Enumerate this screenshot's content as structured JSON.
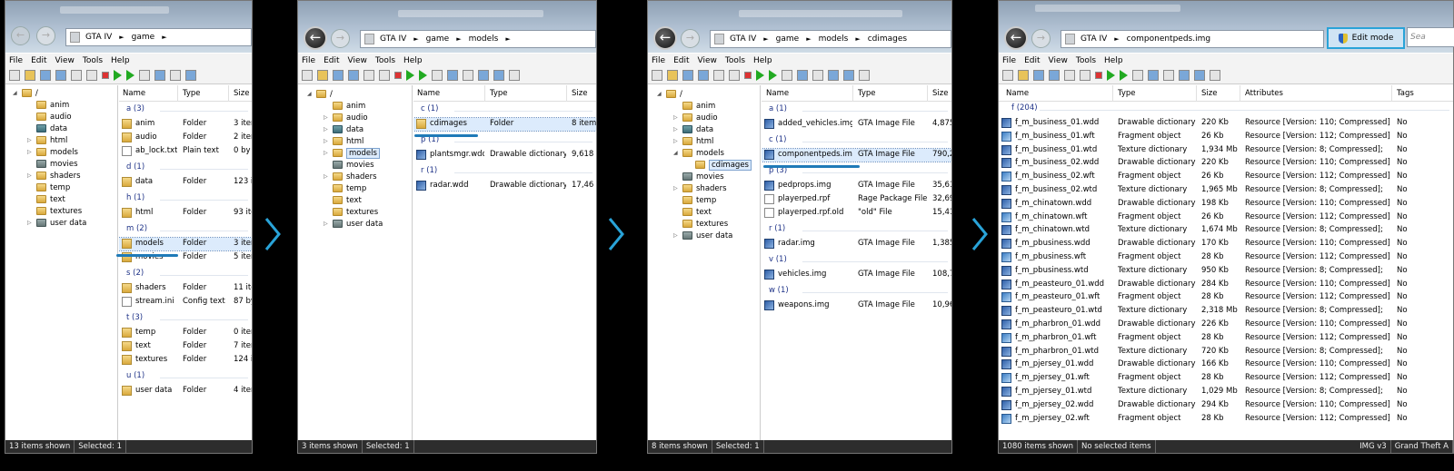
{
  "menu": [
    "File",
    "Edit",
    "View",
    "Tools",
    "Help"
  ],
  "columns": {
    "name": "Name",
    "type": "Type",
    "size": "Size",
    "attributes": "Attributes",
    "tags": "Tags"
  },
  "p1": {
    "breadcrumb": [
      "GTA IV",
      "game"
    ],
    "tree_root": "/",
    "tree": [
      "anim",
      "audio",
      "data",
      "html",
      "models",
      "movies",
      "shaders",
      "temp",
      "text",
      "textures",
      "user data"
    ],
    "groups": [
      {
        "label": "a (3)",
        "rows": [
          [
            "anim",
            "Folder",
            "3 item"
          ],
          [
            "audio",
            "Folder",
            "2 item"
          ],
          [
            "ab_lock.txt",
            "Plain text",
            "0 by"
          ]
        ]
      },
      {
        "label": "d (1)",
        "rows": [
          [
            "data",
            "Folder",
            "123 it"
          ]
        ]
      },
      {
        "label": "h (1)",
        "rows": [
          [
            "html",
            "Folder",
            "93 ite"
          ]
        ]
      },
      {
        "label": "m (2)",
        "rows": [
          [
            "models",
            "Folder",
            "3 item"
          ],
          [
            "movies",
            "Folder",
            "5 item"
          ]
        ]
      },
      {
        "label": "s (2)",
        "rows": [
          [
            "shaders",
            "Folder",
            "11 ite"
          ],
          [
            "stream.ini",
            "Config text",
            "87 by"
          ]
        ]
      },
      {
        "label": "t (3)",
        "rows": [
          [
            "temp",
            "Folder",
            "0 item"
          ],
          [
            "text",
            "Folder",
            "7 item"
          ],
          [
            "textures",
            "Folder",
            "124 it"
          ]
        ]
      },
      {
        "label": "u (1)",
        "rows": [
          [
            "user data",
            "Folder",
            "4 item"
          ]
        ]
      }
    ],
    "status": [
      "13 items shown",
      "Selected: 1"
    ]
  },
  "p2": {
    "breadcrumb": [
      "GTA IV",
      "game",
      "models"
    ],
    "tree_root": "/",
    "tree": [
      "anim",
      "audio",
      "data",
      "html",
      "models",
      "movies",
      "shaders",
      "temp",
      "text",
      "textures",
      "user data"
    ],
    "groups": [
      {
        "label": "c (1)",
        "rows": [
          [
            "cdimages",
            "Folder",
            "8 items"
          ]
        ]
      },
      {
        "label": "p (1)",
        "rows": [
          [
            "plantsmgr.wdd",
            "Drawable dictionary",
            "9,618 K"
          ]
        ]
      },
      {
        "label": "r (1)",
        "rows": [
          [
            "radar.wdd",
            "Drawable dictionary",
            "17,46 K"
          ]
        ]
      }
    ],
    "status": [
      "3 items shown",
      "Selected: 1"
    ]
  },
  "p3": {
    "breadcrumb": [
      "GTA IV",
      "game",
      "models",
      "cdimages"
    ],
    "tree_root": "/",
    "tree": [
      "anim",
      "audio",
      "data",
      "html",
      "models",
      "cdimages",
      "movies",
      "shaders",
      "temp",
      "text",
      "textures",
      "user data"
    ],
    "groups": [
      {
        "label": "a (1)",
        "rows": [
          [
            "added_vehicles.img",
            "GTA Image File",
            "4,875"
          ]
        ]
      },
      {
        "label": "c (1)",
        "rows": [
          [
            "componentpeds.img",
            "GTA Image File",
            "790,2"
          ]
        ]
      },
      {
        "label": "p (3)",
        "rows": [
          [
            "pedprops.img",
            "GTA Image File",
            "35,61"
          ],
          [
            "playerped.rpf",
            "Rage Package File",
            "32,69"
          ],
          [
            "playerped.rpf.old",
            "\"old\" File",
            "15,41"
          ]
        ]
      },
      {
        "label": "r (1)",
        "rows": [
          [
            "radar.img",
            "GTA Image File",
            "1,385"
          ]
        ]
      },
      {
        "label": "v (1)",
        "rows": [
          [
            "vehicles.img",
            "GTA Image File",
            "108,7"
          ]
        ]
      },
      {
        "label": "w (1)",
        "rows": [
          [
            "weapons.img",
            "GTA Image File",
            "10,96"
          ]
        ]
      }
    ],
    "status": [
      "8 items shown",
      "Selected: 1"
    ]
  },
  "p4": {
    "breadcrumb": [
      "GTA IV",
      "componentpeds.img"
    ],
    "edit_mode": "Edit mode",
    "search_placeholder": "Sea",
    "group": "f (204)",
    "rows": [
      [
        "f_m_business_01.wdd",
        "Drawable dictionary",
        "220 Kb",
        "Resource [Version: 110; Compressed];",
        "No"
      ],
      [
        "f_m_business_01.wft",
        "Fragment object",
        "26 Kb",
        "Resource [Version: 112; Compressed];",
        "No"
      ],
      [
        "f_m_business_01.wtd",
        "Texture dictionary",
        "1,934 Mb",
        "Resource [Version: 8; Compressed];",
        "No"
      ],
      [
        "f_m_business_02.wdd",
        "Drawable dictionary",
        "220 Kb",
        "Resource [Version: 110; Compressed];",
        "No"
      ],
      [
        "f_m_business_02.wft",
        "Fragment object",
        "26 Kb",
        "Resource [Version: 112; Compressed];",
        "No"
      ],
      [
        "f_m_business_02.wtd",
        "Texture dictionary",
        "1,965 Mb",
        "Resource [Version: 8; Compressed];",
        "No"
      ],
      [
        "f_m_chinatown.wdd",
        "Drawable dictionary",
        "198 Kb",
        "Resource [Version: 110; Compressed];",
        "No"
      ],
      [
        "f_m_chinatown.wft",
        "Fragment object",
        "26 Kb",
        "Resource [Version: 112; Compressed];",
        "No"
      ],
      [
        "f_m_chinatown.wtd",
        "Texture dictionary",
        "1,674 Mb",
        "Resource [Version: 8; Compressed];",
        "No"
      ],
      [
        "f_m_pbusiness.wdd",
        "Drawable dictionary",
        "170 Kb",
        "Resource [Version: 110; Compressed];",
        "No"
      ],
      [
        "f_m_pbusiness.wft",
        "Fragment object",
        "28 Kb",
        "Resource [Version: 112; Compressed];",
        "No"
      ],
      [
        "f_m_pbusiness.wtd",
        "Texture dictionary",
        "950 Kb",
        "Resource [Version: 8; Compressed];",
        "No"
      ],
      [
        "f_m_peasteuro_01.wdd",
        "Drawable dictionary",
        "284 Kb",
        "Resource [Version: 110; Compressed];",
        "No"
      ],
      [
        "f_m_peasteuro_01.wft",
        "Fragment object",
        "28 Kb",
        "Resource [Version: 112; Compressed];",
        "No"
      ],
      [
        "f_m_peasteuro_01.wtd",
        "Texture dictionary",
        "2,318 Mb",
        "Resource [Version: 8; Compressed];",
        "No"
      ],
      [
        "f_m_pharbron_01.wdd",
        "Drawable dictionary",
        "226 Kb",
        "Resource [Version: 110; Compressed];",
        "No"
      ],
      [
        "f_m_pharbron_01.wft",
        "Fragment object",
        "28 Kb",
        "Resource [Version: 112; Compressed];",
        "No"
      ],
      [
        "f_m_pharbron_01.wtd",
        "Texture dictionary",
        "720 Kb",
        "Resource [Version: 8; Compressed];",
        "No"
      ],
      [
        "f_m_pjersey_01.wdd",
        "Drawable dictionary",
        "166 Kb",
        "Resource [Version: 110; Compressed];",
        "No"
      ],
      [
        "f_m_pjersey_01.wft",
        "Fragment object",
        "28 Kb",
        "Resource [Version: 112; Compressed];",
        "No"
      ],
      [
        "f_m_pjersey_01.wtd",
        "Texture dictionary",
        "1,029 Mb",
        "Resource [Version: 8; Compressed];",
        "No"
      ],
      [
        "f_m_pjersey_02.wdd",
        "Drawable dictionary",
        "294 Kb",
        "Resource [Version: 110; Compressed];",
        "No"
      ],
      [
        "f_m_pjersey_02.wft",
        "Fragment object",
        "28 Kb",
        "Resource [Version: 112; Compressed];",
        "No"
      ]
    ],
    "status": [
      "1080 items shown",
      "No selected items",
      "IMG v3",
      "Grand Theft A"
    ]
  },
  "colors": {
    "accent": "#1f7ab8",
    "arrow": "#29a3d8",
    "selection": "#dcebfc"
  }
}
